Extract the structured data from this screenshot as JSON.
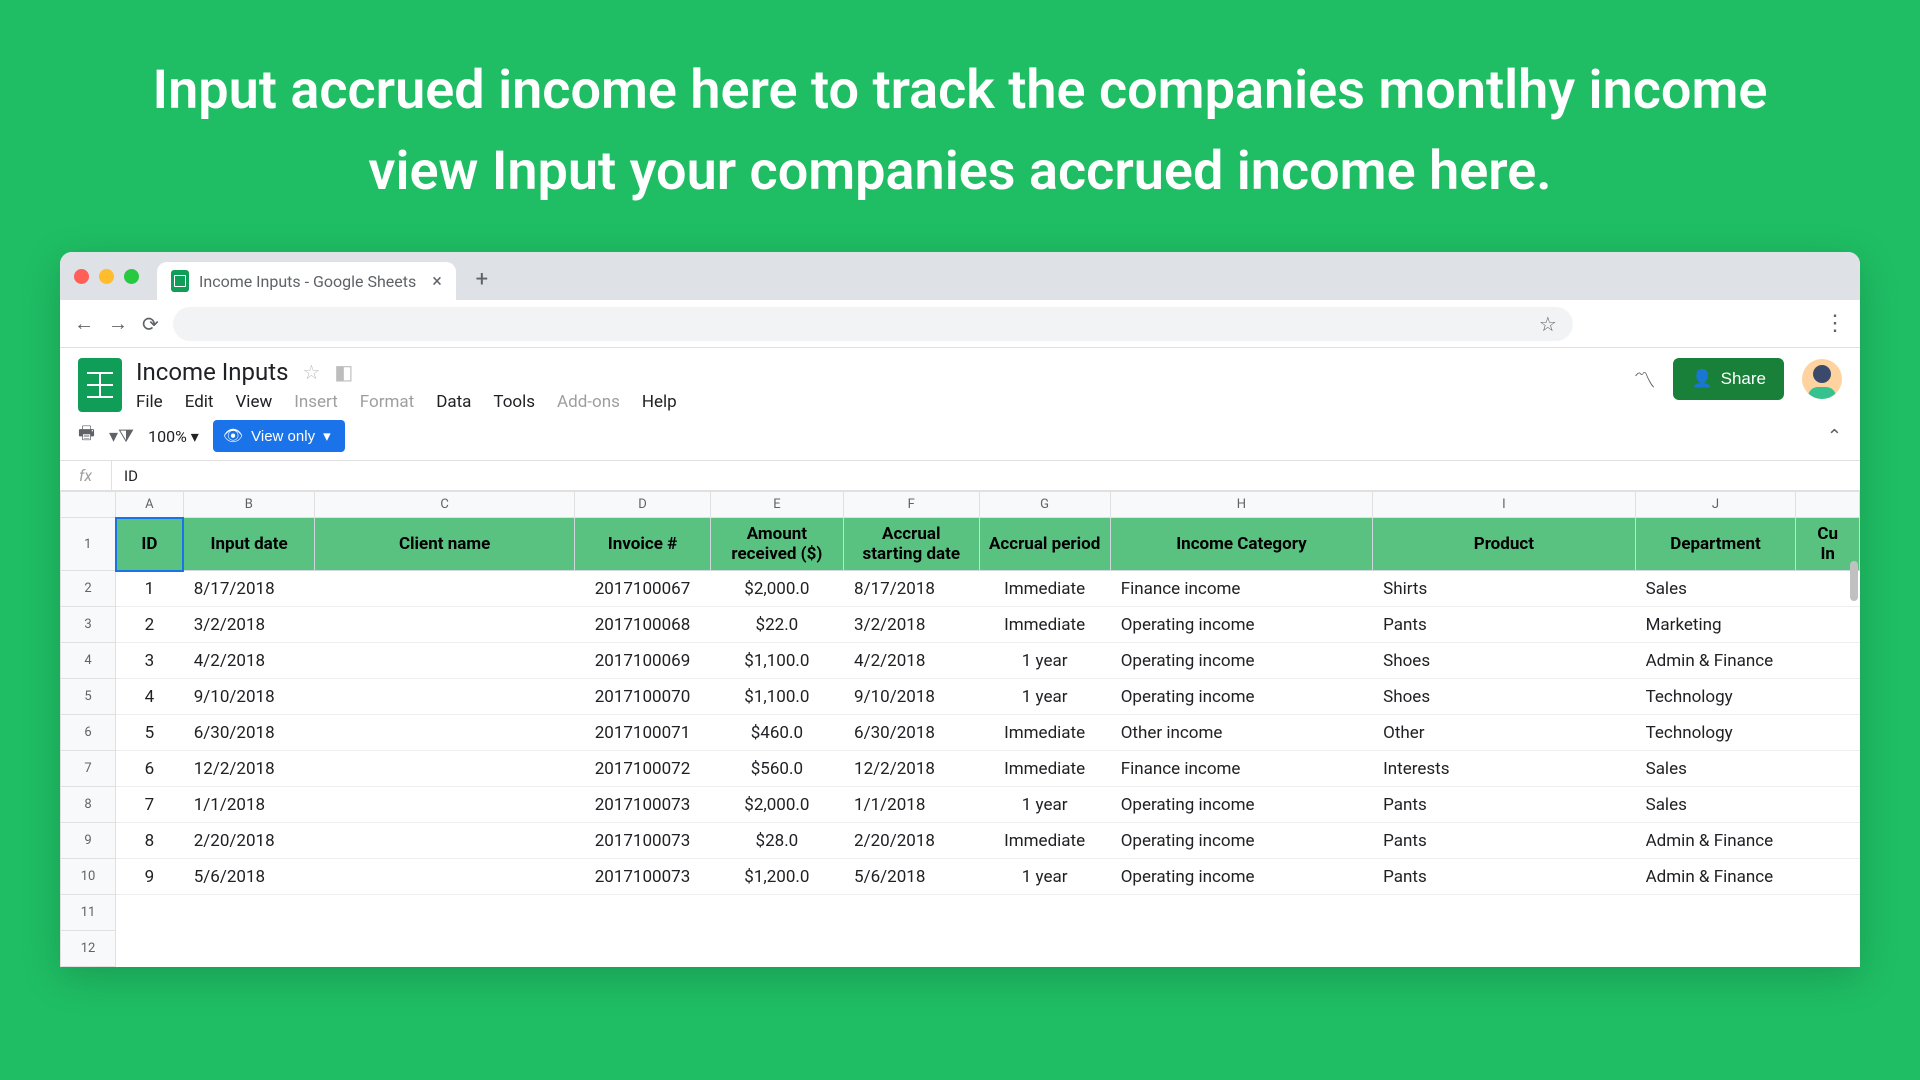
{
  "caption": "Input accrued income here to track the companies montlhy income view Input your companies accrued income here.",
  "browser": {
    "tab_title": "Income Inputs - Google Sheets"
  },
  "doc": {
    "title": "Income Inputs",
    "menus": [
      "File",
      "Edit",
      "View",
      "Insert",
      "Format",
      "Data",
      "Tools",
      "Add-ons",
      "Help"
    ],
    "muted_menus": [
      "Insert",
      "Format",
      "Add-ons"
    ],
    "share": "Share",
    "zoom": "100%",
    "viewonly": "View only"
  },
  "fx": {
    "value": "ID"
  },
  "columns": [
    "A",
    "B",
    "C",
    "D",
    "E",
    "F",
    "G",
    "H",
    "I",
    "J"
  ],
  "last_col_partial": "Cu\nIn",
  "headers": [
    "ID",
    "Input date",
    "Client name",
    "Invoice #",
    "Amount received ($)",
    "Accrual starting date",
    "Accrual period",
    "Income Category",
    "Product",
    "Department"
  ],
  "rows": [
    {
      "n": 1,
      "date": "8/17/2018",
      "client": "",
      "inv": "2017100067",
      "amt": "$2,000.0",
      "start": "8/17/2018",
      "period": "Immediate",
      "cat": "Finance income",
      "prod": "Shirts",
      "dept": "Sales"
    },
    {
      "n": 2,
      "date": "3/2/2018",
      "client": "",
      "inv": "2017100068",
      "amt": "$22.0",
      "start": "3/2/2018",
      "period": "Immediate",
      "cat": "Operating income",
      "prod": "Pants",
      "dept": "Marketing"
    },
    {
      "n": 3,
      "date": "4/2/2018",
      "client": "",
      "inv": "2017100069",
      "amt": "$1,100.0",
      "start": "4/2/2018",
      "period": "1 year",
      "cat": "Operating income",
      "prod": "Shoes",
      "dept": "Admin & Finance"
    },
    {
      "n": 4,
      "date": "9/10/2018",
      "client": "",
      "inv": "2017100070",
      "amt": "$1,100.0",
      "start": "9/10/2018",
      "period": "1 year",
      "cat": "Operating income",
      "prod": "Shoes",
      "dept": "Technology"
    },
    {
      "n": 5,
      "date": "6/30/2018",
      "client": "",
      "inv": "2017100071",
      "amt": "$460.0",
      "start": "6/30/2018",
      "period": "Immediate",
      "cat": "Other income",
      "prod": "Other",
      "dept": "Technology"
    },
    {
      "n": 6,
      "date": "12/2/2018",
      "client": "",
      "inv": "2017100072",
      "amt": "$560.0",
      "start": "12/2/2018",
      "period": "Immediate",
      "cat": "Finance income",
      "prod": "Interests",
      "dept": "Sales"
    },
    {
      "n": 7,
      "date": "1/1/2018",
      "client": "",
      "inv": "2017100073",
      "amt": "$2,000.0",
      "start": "1/1/2018",
      "period": "1 year",
      "cat": "Operating income",
      "prod": "Pants",
      "dept": "Sales"
    },
    {
      "n": 8,
      "date": "2/20/2018",
      "client": "",
      "inv": "2017100073",
      "amt": "$28.0",
      "start": "2/20/2018",
      "period": "Immediate",
      "cat": "Operating income",
      "prod": "Pants",
      "dept": "Admin & Finance"
    },
    {
      "n": 9,
      "date": "5/6/2018",
      "client": "",
      "inv": "2017100073",
      "amt": "$1,200.0",
      "start": "5/6/2018",
      "period": "1 year",
      "cat": "Operating income",
      "prod": "Pants",
      "dept": "Admin & Finance"
    }
  ],
  "row_numbers_extra": [
    11,
    12
  ]
}
